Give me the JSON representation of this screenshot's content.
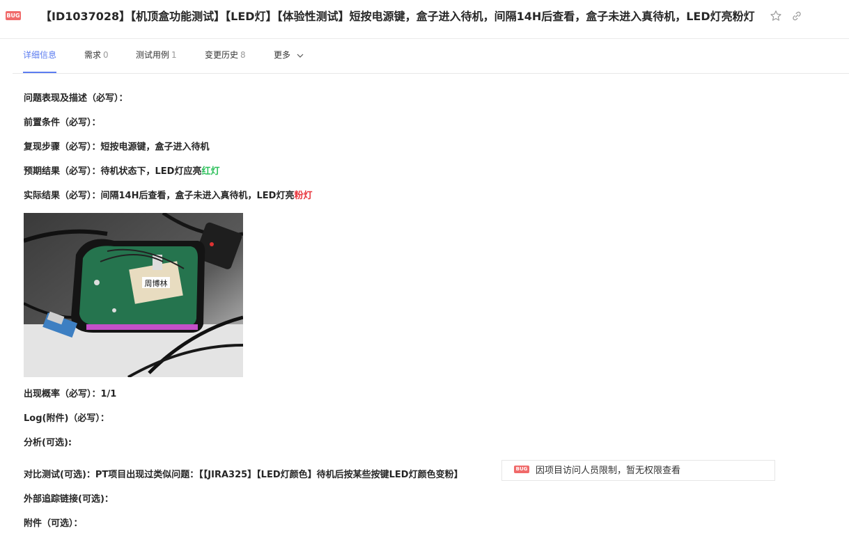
{
  "header": {
    "badge": "BUG",
    "title": "【ID1037028】【机顶盒功能测试】【LED灯】【体验性测试】短按电源键，盒子进入待机，间隔14H后查看，盒子未进入真待机，LED灯亮粉灯",
    "icons": [
      "star-icon",
      "link-icon"
    ]
  },
  "tabs": [
    {
      "label": "详细信息",
      "count": ""
    },
    {
      "label": "需求",
      "count": "0"
    },
    {
      "label": "测试用例",
      "count": "1"
    },
    {
      "label": "变更历史",
      "count": "8"
    },
    {
      "label": "更多",
      "count": ""
    }
  ],
  "fields": {
    "desc": {
      "label": "问题表现及描述（必写）：",
      "value": ""
    },
    "precondition": {
      "label": "前置条件（必写）：",
      "value": ""
    },
    "steps": {
      "label": "复现步骤（必写）：",
      "value": "短按电源键，盒子进入待机"
    },
    "expected": {
      "label": "预期结果（必写）：",
      "value": "待机状态下，LED灯应亮",
      "highlight": "红灯",
      "highlight_color": "#2ec05c"
    },
    "actual": {
      "label": "实际结果（必写）：",
      "value": "间隔14H后查看，盒子未进入真待机，LED灯亮",
      "highlight": "粉灯",
      "highlight_color": "#e8363d"
    },
    "photo_label": "周博林",
    "probability": {
      "label": "出现概率（必写）：",
      "value": "1/1"
    },
    "log": {
      "label": "Log(附件)（必写）：",
      "value": ""
    },
    "analysis": {
      "label": "分析(可选):",
      "value": ""
    },
    "compare": {
      "label": "对比测试(可选)：",
      "value": "PT项目出现过类似问题：【【JIRA325】【LED灯颜色】待机后按某些按键LED灯颜色变粉】"
    },
    "external": {
      "label": "外部追踪链接(可选)：",
      "value": ""
    },
    "attachment": {
      "label": "附件（可选）：",
      "value": ""
    }
  },
  "ref_card": {
    "badge": "BUG",
    "text": "因项目访问人员限制，暂无权限查看"
  },
  "colors": {
    "accent": "#5b7cf0",
    "bug_badge": "#f06a6a"
  }
}
